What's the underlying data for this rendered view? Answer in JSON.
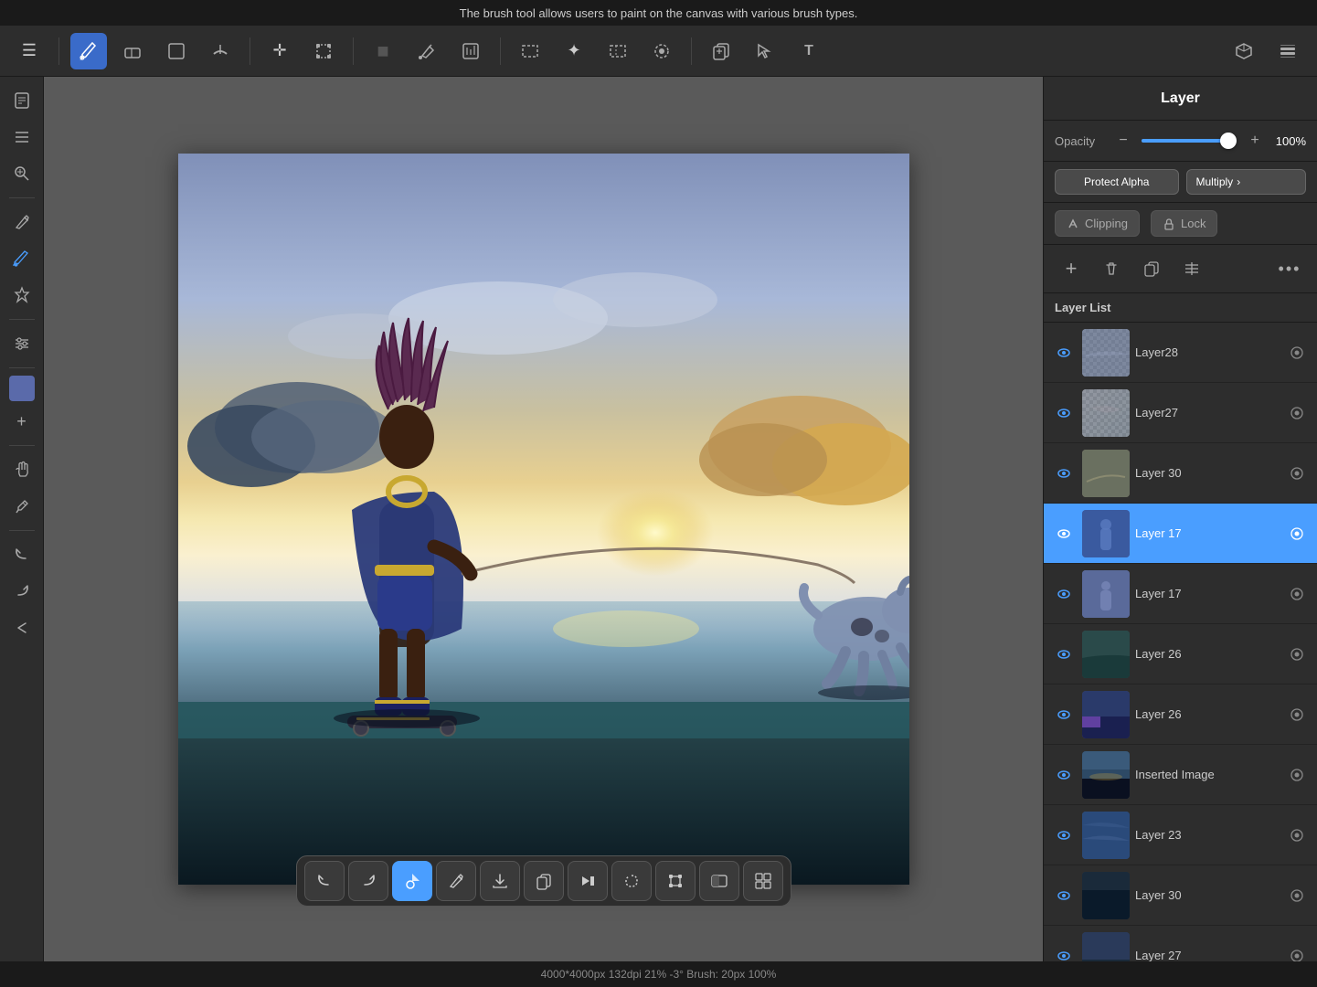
{
  "topBar": {
    "message": "The brush tool allows users to paint on the canvas with various brush types."
  },
  "toolbar": {
    "tools": [
      {
        "id": "menu",
        "icon": "☰",
        "label": "Menu"
      },
      {
        "id": "brush",
        "icon": "✏",
        "label": "Brush",
        "active": true
      },
      {
        "id": "eraser",
        "icon": "◇",
        "label": "Eraser"
      },
      {
        "id": "canvas",
        "icon": "⬜",
        "label": "Canvas"
      },
      {
        "id": "smudge",
        "icon": "⌒",
        "label": "Smudge"
      },
      {
        "id": "move",
        "icon": "✛",
        "label": "Move"
      },
      {
        "id": "transform",
        "icon": "⬚",
        "label": "Transform"
      },
      {
        "id": "fill-color",
        "icon": "■",
        "label": "Fill Color"
      },
      {
        "id": "fill",
        "icon": "◉",
        "label": "Fill"
      },
      {
        "id": "adjust",
        "icon": "⬜",
        "label": "Adjust"
      },
      {
        "id": "select-rect",
        "icon": "⬜",
        "label": "Select Rectangle"
      },
      {
        "id": "select-point",
        "icon": "✦",
        "label": "Select Point"
      },
      {
        "id": "select-free",
        "icon": "⬚",
        "label": "Select Free"
      },
      {
        "id": "select-auto",
        "icon": "◈",
        "label": "Select Auto"
      },
      {
        "id": "copy-paste",
        "icon": "⬚",
        "label": "Copy Paste"
      },
      {
        "id": "select-tool",
        "icon": "⬚",
        "label": "Select Tool"
      },
      {
        "id": "text",
        "icon": "T",
        "label": "Text"
      }
    ],
    "rightIcons": [
      {
        "id": "3d",
        "icon": "⬡",
        "label": "3D"
      },
      {
        "id": "layers",
        "icon": "⧉",
        "label": "Layers"
      }
    ]
  },
  "leftSidebar": {
    "tools": [
      {
        "id": "document",
        "icon": "📄",
        "label": "Document"
      },
      {
        "id": "list",
        "icon": "≡",
        "label": "List"
      },
      {
        "id": "search",
        "icon": "🔍",
        "label": "Search"
      },
      {
        "id": "pen",
        "icon": "✏",
        "label": "Pen"
      },
      {
        "id": "paint",
        "icon": "🖌",
        "label": "Paint"
      },
      {
        "id": "sticker",
        "icon": "⬡",
        "label": "Sticker"
      },
      {
        "id": "effects",
        "icon": "☰",
        "label": "Effects"
      },
      {
        "id": "palette",
        "icon": "🎨",
        "label": "Palette"
      },
      {
        "id": "add-color",
        "icon": "+",
        "label": "Add Color"
      },
      {
        "id": "hand",
        "icon": "✋",
        "label": "Hand"
      },
      {
        "id": "eyedropper",
        "icon": "🔬",
        "label": "Eyedropper"
      },
      {
        "id": "undo",
        "icon": "↩",
        "label": "Undo"
      },
      {
        "id": "redo",
        "icon": "↪",
        "label": "Redo"
      },
      {
        "id": "back",
        "icon": "↩",
        "label": "Back"
      }
    ]
  },
  "layerPanel": {
    "title": "Layer",
    "opacity": {
      "label": "Opacity",
      "value": "100%",
      "percent": 100
    },
    "protectAlpha": {
      "label": "Protect Alpha"
    },
    "blendMode": {
      "label": "Multiply",
      "hasChevron": true
    },
    "clipping": {
      "label": "Clipping"
    },
    "lock": {
      "label": "Lock"
    },
    "layerListTitle": "Layer List",
    "layers": [
      {
        "id": "layer28",
        "name": "Layer28",
        "visible": true,
        "thumbClass": "thumb-28",
        "selected": false
      },
      {
        "id": "layer27",
        "name": "Layer27",
        "visible": true,
        "thumbClass": "thumb-27",
        "selected": false
      },
      {
        "id": "layer30a",
        "name": "Layer 30",
        "visible": true,
        "thumbClass": "thumb-30",
        "selected": false
      },
      {
        "id": "layer17-selected",
        "name": "Layer 17",
        "visible": true,
        "thumbClass": "thumb-17-selected",
        "selected": true
      },
      {
        "id": "layer17",
        "name": "Layer 17",
        "visible": true,
        "thumbClass": "thumb-17",
        "selected": false
      },
      {
        "id": "layer26a",
        "name": "Layer 26",
        "visible": true,
        "thumbClass": "thumb-26a",
        "selected": false
      },
      {
        "id": "layer26b",
        "name": "Layer 26",
        "visible": true,
        "thumbClass": "thumb-26b",
        "selected": false
      },
      {
        "id": "inserted-image",
        "name": "Inserted Image",
        "visible": true,
        "thumbClass": "thumb-inserted",
        "selected": false
      },
      {
        "id": "layer23",
        "name": "Layer 23",
        "visible": true,
        "thumbClass": "thumb-23",
        "selected": false
      },
      {
        "id": "layer30b",
        "name": "Layer 30",
        "visible": true,
        "thumbClass": "thumb-30b",
        "selected": false
      },
      {
        "id": "layer27b",
        "name": "Layer 27",
        "visible": true,
        "thumbClass": "thumb-27b",
        "selected": false
      }
    ]
  },
  "bottomToolbar": {
    "tools": [
      {
        "id": "undo",
        "icon": "↩",
        "label": "Undo"
      },
      {
        "id": "redo",
        "icon": "↪",
        "label": "Redo"
      },
      {
        "id": "brush-select",
        "icon": "✦",
        "label": "Brush Select",
        "active": true
      },
      {
        "id": "pencil",
        "icon": "✏",
        "label": "Pencil"
      },
      {
        "id": "download",
        "icon": "⬇",
        "label": "Download"
      },
      {
        "id": "duplicate",
        "icon": "⬚",
        "label": "Duplicate"
      },
      {
        "id": "skip",
        "icon": "⏭",
        "label": "Skip"
      },
      {
        "id": "lasso",
        "icon": "⬚",
        "label": "Lasso"
      },
      {
        "id": "transform2",
        "icon": "⬚",
        "label": "Transform"
      },
      {
        "id": "adjust2",
        "icon": "⬜",
        "label": "Adjust"
      },
      {
        "id": "grid",
        "icon": "⊞",
        "label": "Grid"
      }
    ]
  },
  "statusBar": {
    "text": "4000*4000px 132dpi 21% -3° Brush: 20px 100%"
  }
}
